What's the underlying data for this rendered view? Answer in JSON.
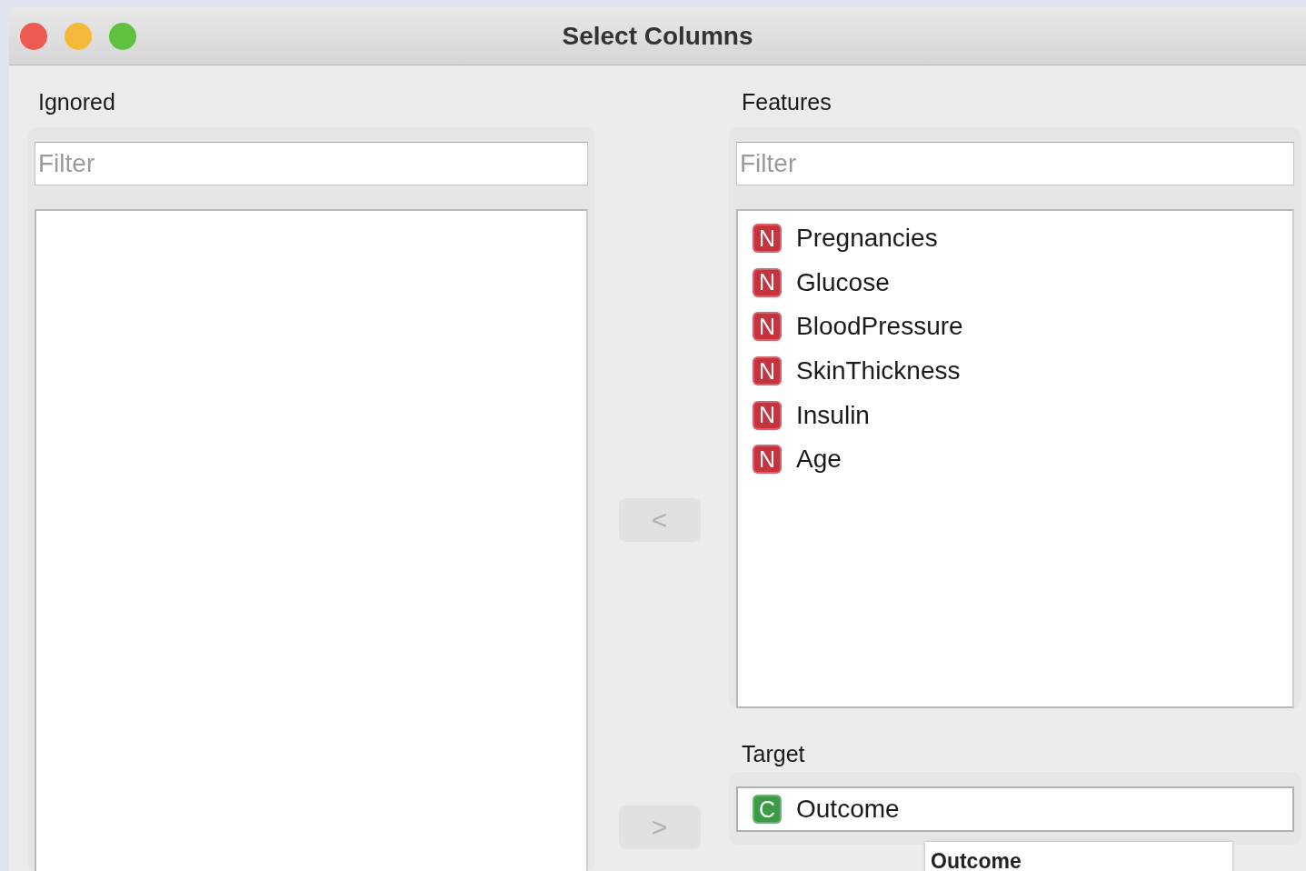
{
  "window": {
    "title": "Select Columns"
  },
  "ignored": {
    "label": "Ignored",
    "filter": {
      "placeholder": "Filter"
    }
  },
  "move_buttons": [
    {
      "label": "<",
      "disabled": true
    },
    {
      "label": ">",
      "disabled": true
    }
  ],
  "features": {
    "label": "Features",
    "filter": {
      "placeholder": "Filter"
    },
    "items": [
      {
        "name": "Pregnancies",
        "kind": "numeric",
        "type_letter": "N"
      },
      {
        "name": "Glucose",
        "kind": "numeric",
        "type_letter": "N"
      },
      {
        "name": "BloodPressure",
        "kind": "numeric",
        "type_letter": "N"
      },
      {
        "name": "SkinThickness",
        "kind": "numeric",
        "type_letter": "N"
      },
      {
        "name": "Insulin",
        "kind": "numeric",
        "type_letter": "N"
      },
      {
        "name": "Age",
        "kind": "numeric",
        "type_letter": "N"
      }
    ]
  },
  "target": {
    "label": "Target",
    "items": [
      {
        "name": "Outcome",
        "kind": "categorical",
        "type_letter": "C"
      }
    ]
  },
  "tooltip": {
    "text": "Outcome"
  }
}
